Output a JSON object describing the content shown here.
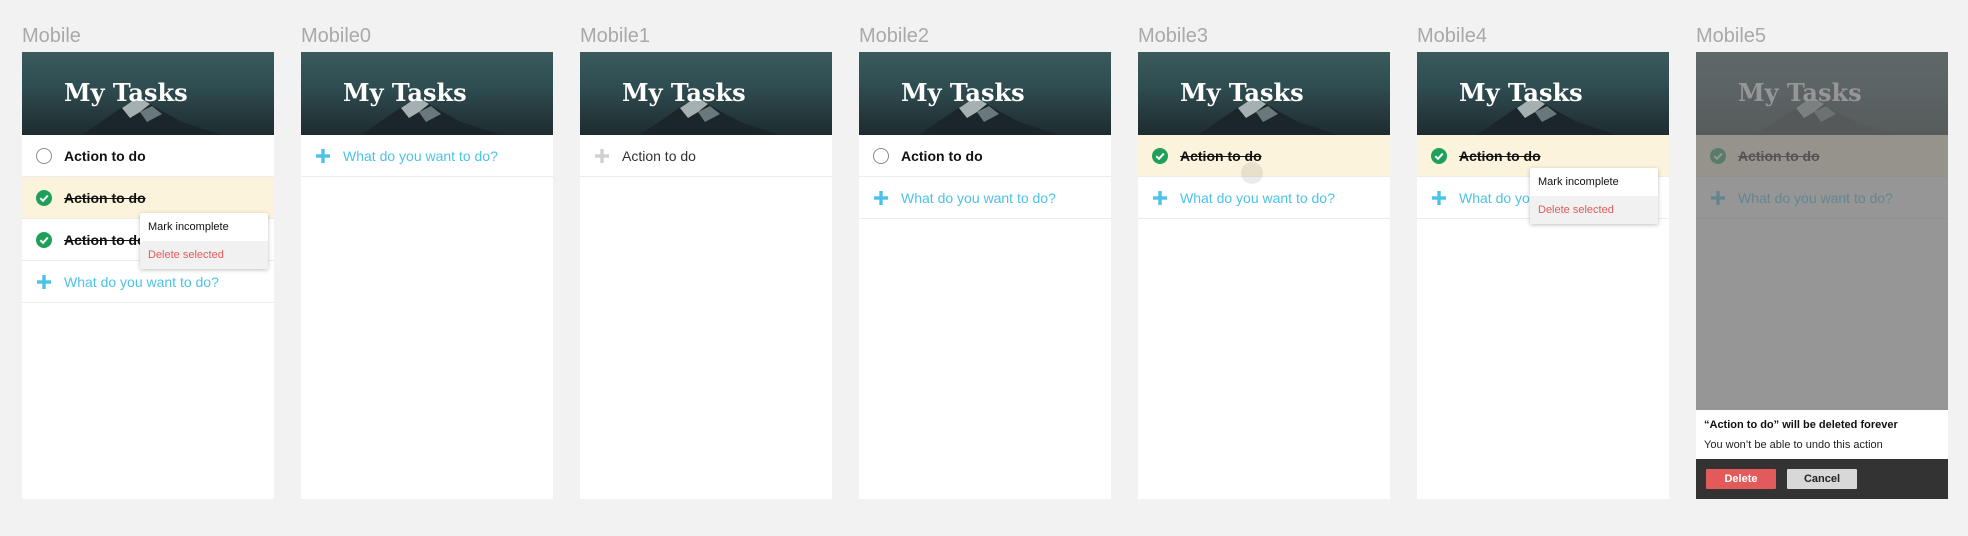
{
  "app_title": "My Tasks",
  "frames": [
    {
      "label": "Mobile"
    },
    {
      "label": "Mobile0"
    },
    {
      "label": "Mobile1"
    },
    {
      "label": "Mobile2"
    },
    {
      "label": "Mobile3"
    },
    {
      "label": "Mobile4"
    },
    {
      "label": "Mobile5"
    }
  ],
  "task": {
    "label": "Action to do"
  },
  "new_task": {
    "placeholder": "What do you want to do?"
  },
  "context_menu": {
    "mark_incomplete": "Mark incomplete",
    "delete_selected": "Delete selected"
  },
  "dialog": {
    "title": "“Action to do” will be deleted forever",
    "body": "You won’t be able to undo this action",
    "delete_label": "Delete",
    "cancel_label": "Cancel"
  },
  "colors": {
    "background": "#f2f2f2",
    "accent": "#4cc3e6",
    "complete": "#1fa05a",
    "danger": "#e35a5a",
    "selected_row": "#fbf3dc",
    "dialog_bar": "#333333"
  },
  "icons": [
    "radio-empty-icon",
    "check-circle-icon",
    "plus-icon",
    "mountain-image"
  ]
}
